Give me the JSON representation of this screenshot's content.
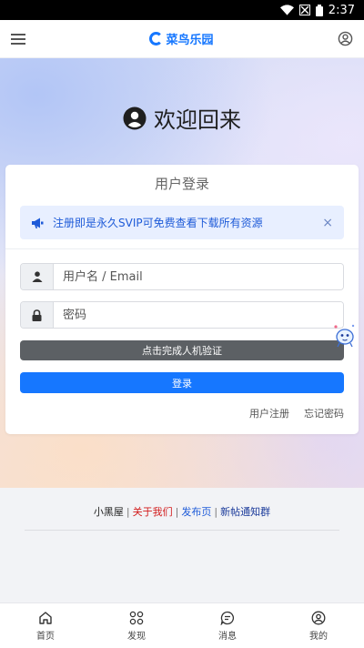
{
  "status_bar": {
    "time": "2:37"
  },
  "app_bar": {
    "brand": "菜鸟乐园"
  },
  "welcome": {
    "title": "欢迎回来"
  },
  "login_card": {
    "title": "用户登录",
    "notice": {
      "text": "注册即是永久SVIP可免费查看下载所有资源",
      "close": "×"
    },
    "username_placeholder": "用户名 / Email",
    "password_placeholder": "密码",
    "captcha_label": "点击完成人机验证",
    "submit_label": "登录",
    "register_link": "用户注册",
    "forgot_link": "忘记密码"
  },
  "footer": {
    "links": [
      "小黑屋",
      "关于我们",
      "发布页",
      "新帖通知群"
    ],
    "separator": "|"
  },
  "tabs": [
    {
      "label": "首页",
      "icon": "home-icon"
    },
    {
      "label": "发现",
      "icon": "grid-icon"
    },
    {
      "label": "消息",
      "icon": "message-icon"
    },
    {
      "label": "我的",
      "icon": "user-icon"
    }
  ],
  "colors": {
    "accent": "#1677ff",
    "notice_bg": "#e8efff",
    "captcha_bg": "#5c6064",
    "link_red": "#d21b1b"
  }
}
